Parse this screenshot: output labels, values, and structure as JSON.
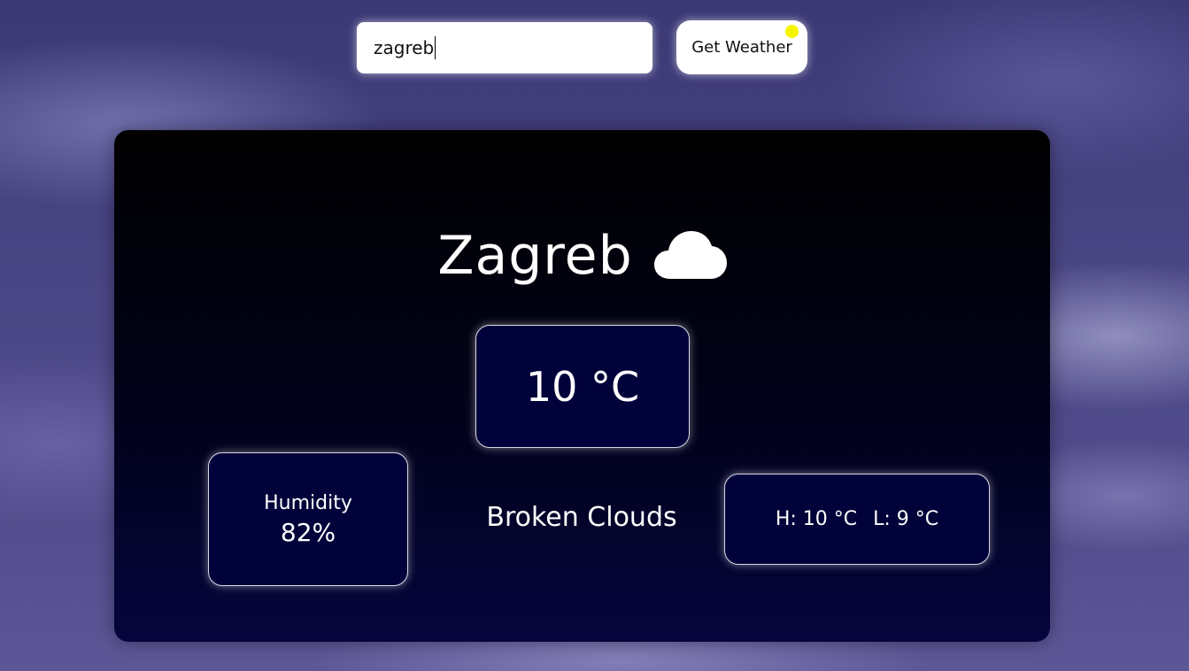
{
  "search": {
    "value": "zagreb"
  },
  "button": {
    "label": "Get Weather"
  },
  "weather": {
    "city": "Zagreb",
    "icon": "cloud-icon",
    "temperature": "10 °C",
    "humidity_label": "Humidity",
    "humidity_value": "82%",
    "condition": "Broken Clouds",
    "high": "H: 10 °C",
    "low": "L: 9 °C"
  },
  "colors": {
    "card_bottom": "#05053d",
    "box_bg": "#02023a",
    "button_dot": "#f5f500"
  }
}
